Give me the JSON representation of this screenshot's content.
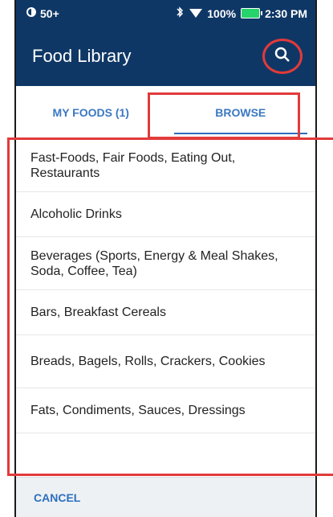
{
  "status_bar": {
    "notification": "50+",
    "battery": "100%",
    "time": "2:30 PM"
  },
  "app_bar": {
    "title": "Food Library"
  },
  "tabs": [
    {
      "label": "MY FOODS (1)",
      "active": false
    },
    {
      "label": "BROWSE",
      "active": true
    }
  ],
  "categories": [
    "Fast-Foods, Fair Foods, Eating Out, Restaurants",
    "Alcoholic Drinks",
    "Beverages (Sports, Energy & Meal Shakes, Soda, Coffee, Tea)",
    "Bars, Breakfast Cereals",
    "Breads, Bagels, Rolls, Crackers, Cookies",
    "Fats, Condiments, Sauces, Dressings"
  ],
  "footer": {
    "cancel_label": "CANCEL"
  },
  "colors": {
    "primary": "#0f3766",
    "accent": "#2c6fbe",
    "highlight": "#e23a3a",
    "battery": "#27d36b"
  }
}
